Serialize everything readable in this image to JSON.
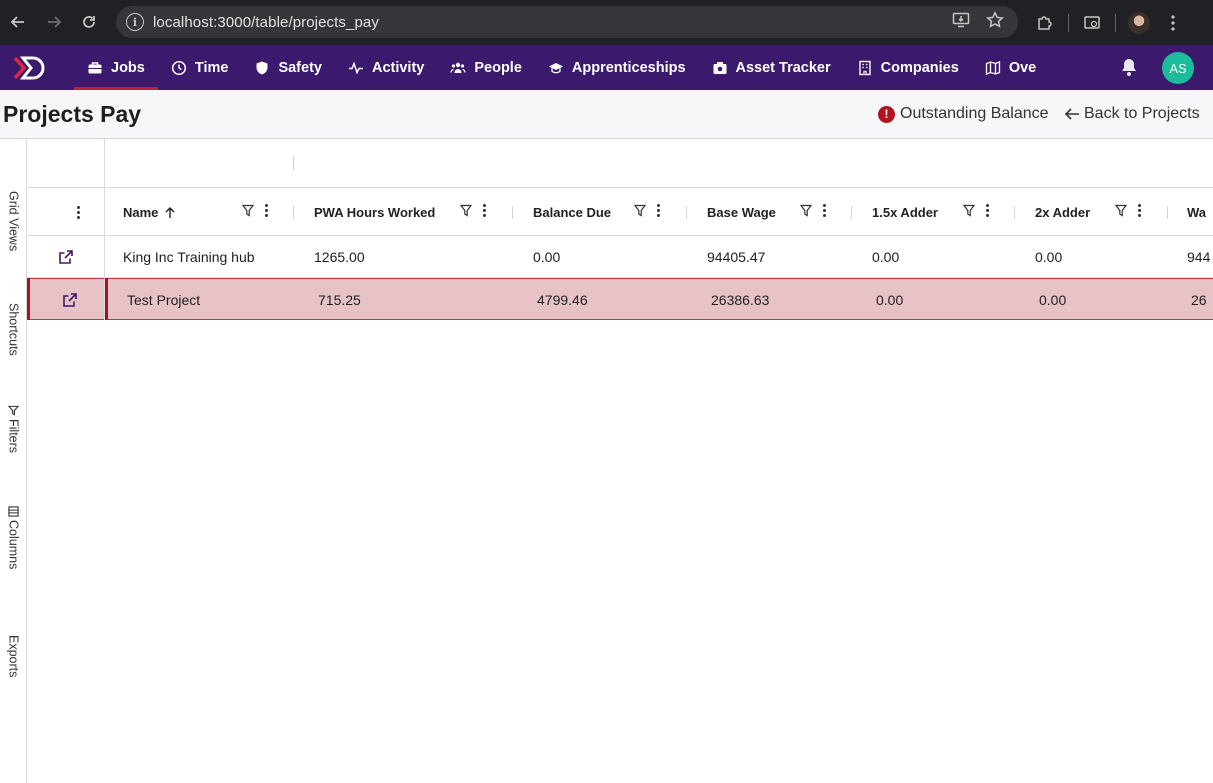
{
  "browser": {
    "url_host": "localhost",
    "url_path": ":3000/table/projects_pay"
  },
  "nav": {
    "items": [
      {
        "label": "Jobs",
        "icon": "briefcase-icon",
        "active": true
      },
      {
        "label": "Time",
        "icon": "clock-icon"
      },
      {
        "label": "Safety",
        "icon": "shield-icon"
      },
      {
        "label": "Activity",
        "icon": "activity-icon"
      },
      {
        "label": "People",
        "icon": "people-icon"
      },
      {
        "label": "Apprenticeships",
        "icon": "graduation-cap-icon"
      },
      {
        "label": "Asset Tracker",
        "icon": "camera-icon"
      },
      {
        "label": "Companies",
        "icon": "building-icon"
      },
      {
        "label": "Ove",
        "icon": "map-icon"
      }
    ],
    "avatar_initials": "AS",
    "colors": {
      "nav_bg": "#3b1a6e",
      "active_underline": "#c0203a",
      "avatar_bg": "#1abc9c"
    }
  },
  "page": {
    "title": "Projects Pay",
    "outstanding_label": "Outstanding Balance",
    "back_label": "Back to Projects"
  },
  "sidebar": {
    "tabs": [
      "Grid Views",
      "Shortcuts",
      "Filters",
      "Columns",
      "Exports"
    ]
  },
  "table": {
    "columns": [
      "Name",
      "PWA Hours Worked",
      "Balance Due",
      "Base Wage",
      "1.5x Adder",
      "2x Adder",
      "Wa"
    ],
    "sort": {
      "column": "Name",
      "direction": "asc"
    },
    "rows": [
      {
        "name": "King Inc Training hub",
        "pwa_hours": "1265.00",
        "balance_due": "0.00",
        "base_wage": "94405.47",
        "adder_15": "0.00",
        "adder_2": "0.00",
        "wage_partial": "944",
        "selected": false
      },
      {
        "name": "Test Project",
        "pwa_hours": "715.25",
        "balance_due": "4799.46",
        "base_wage": "26386.63",
        "adder_15": "0.00",
        "adder_2": "0.00",
        "wage_partial": "26",
        "selected": true
      }
    ],
    "colors": {
      "selected_row_bg": "#e7c2c6",
      "selected_row_border": "#a0151f"
    }
  }
}
